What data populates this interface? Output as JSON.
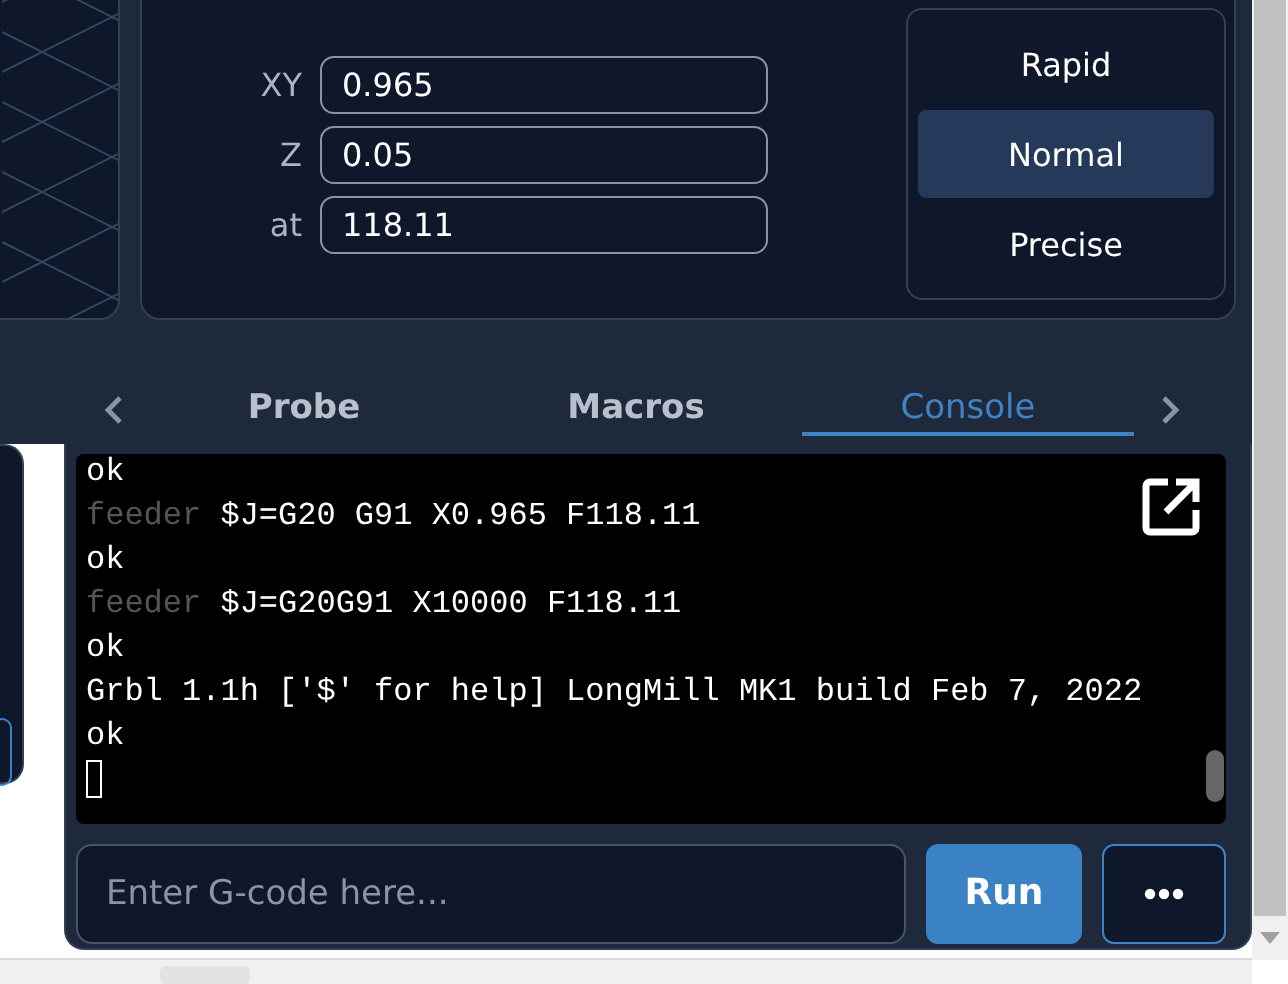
{
  "jog_inputs": [
    {
      "label": "XY",
      "value": "0.965"
    },
    {
      "label": "Z",
      "value": "0.05"
    },
    {
      "label": "at",
      "value": "118.11"
    }
  ],
  "speed_modes": [
    {
      "label": "Rapid",
      "selected": false
    },
    {
      "label": "Normal",
      "selected": true
    },
    {
      "label": "Precise",
      "selected": false
    }
  ],
  "tabs": [
    {
      "label": "Probe",
      "selected": false
    },
    {
      "label": "Macros",
      "selected": false
    },
    {
      "label": "Console",
      "selected": true
    }
  ],
  "console": {
    "lines": [
      {
        "kind": "response",
        "text": "ok"
      },
      {
        "kind": "command",
        "source": "feeder",
        "text": "$J=G20 G91 X0.965 F118.11"
      },
      {
        "kind": "response",
        "text": "ok"
      },
      {
        "kind": "command",
        "source": "feeder",
        "text": "$J=G20G91 X10000 F118.11"
      },
      {
        "kind": "response",
        "text": "ok"
      },
      {
        "kind": "response",
        "text": "Grbl 1.1h ['$' for help] LongMill MK1 build Feb 7, 2022"
      },
      {
        "kind": "response",
        "text": "ok"
      }
    ],
    "input": {
      "placeholder": "Enter G-code here..."
    },
    "run_button": "Run"
  }
}
